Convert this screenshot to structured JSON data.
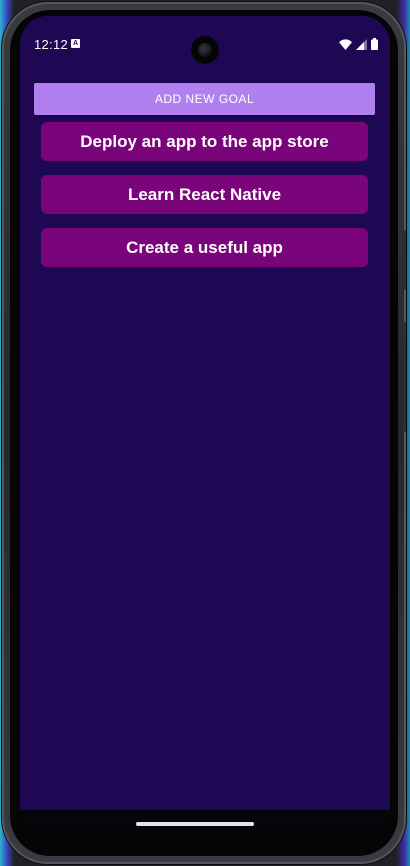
{
  "status_bar": {
    "time": "12:12",
    "notification_icon": "A",
    "icons": [
      "wifi-icon",
      "signal-icon",
      "battery-icon"
    ]
  },
  "app": {
    "add_button_label": "ADD NEW GOAL",
    "goals": [
      "Deploy an app to the app store",
      "Learn React Native",
      "Create a useful app"
    ]
  },
  "colors": {
    "background": "#1e0853",
    "add_button": "#b180f0",
    "goal_item": "#7a0479"
  }
}
